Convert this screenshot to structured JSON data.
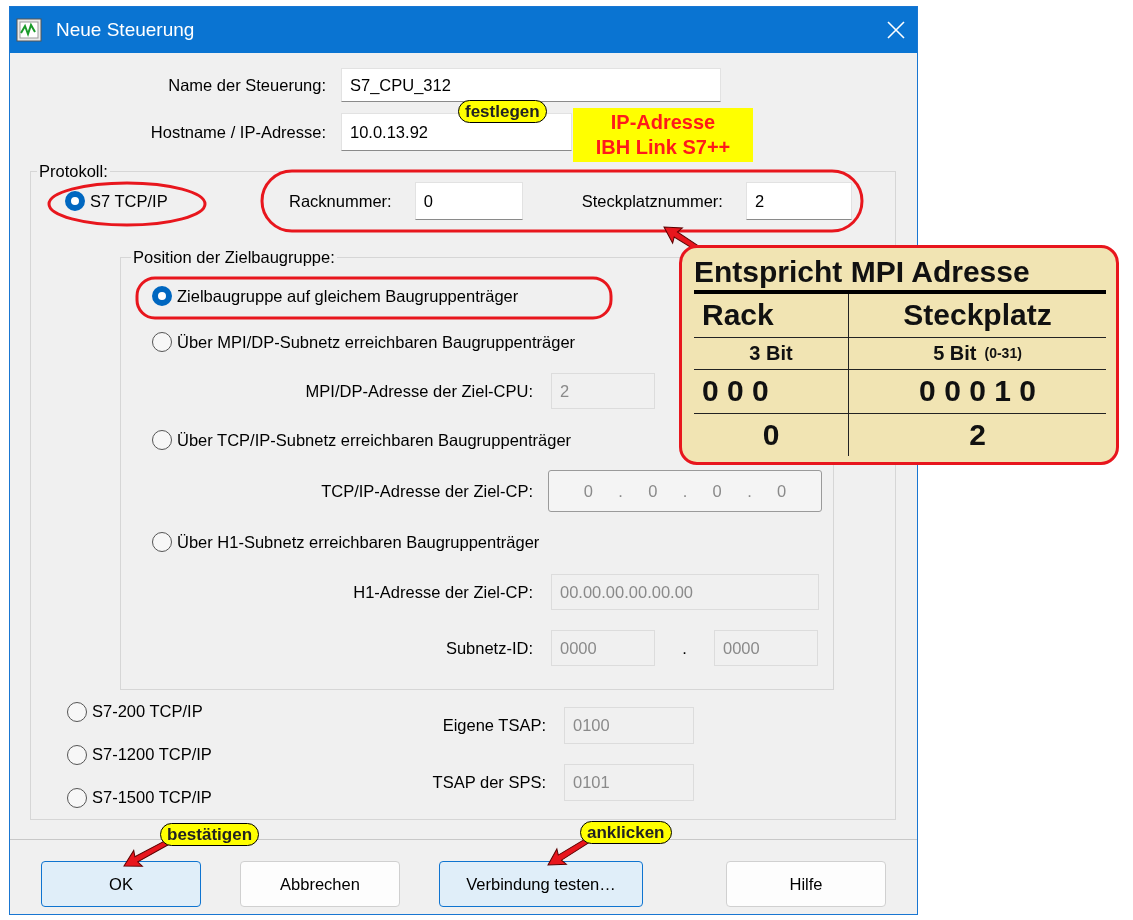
{
  "window": {
    "title": "Neue Steuerung"
  },
  "fields": [
    {
      "label": "Name der Steuerung:",
      "value": "S7_CPU_312"
    },
    {
      "label": "Hostname / IP-Adresse:",
      "value": "10.0.13.92"
    }
  ],
  "protocol_group": {
    "title": "Protokoll:",
    "protocols": [
      {
        "label": "S7 TCP/IP",
        "selected": true
      },
      {
        "label": "S7-200 TCP/IP",
        "selected": false
      },
      {
        "label": "S7-1200 TCP/IP",
        "selected": false
      },
      {
        "label": "S7-1500 TCP/IP",
        "selected": false
      }
    ],
    "rack": {
      "label": "Racknummer:",
      "value": "0"
    },
    "slot": {
      "label": "Steckplatznummer:",
      "value": "2"
    },
    "position_group": {
      "title": "Position der Zielbaugruppe:",
      "rows": [
        {
          "kind": "option",
          "label": "Zielbaugruppe auf gleichem Baugruppenträger",
          "selected": true
        },
        {
          "kind": "option",
          "label": "Über MPI/DP-Subnetz erreichbaren Baugruppenträger",
          "selected": false
        },
        {
          "kind": "field",
          "label": "MPI/DP-Adresse der Ziel-CPU:",
          "value": "2",
          "disabled": true
        },
        {
          "kind": "option",
          "label": "Über TCP/IP-Subnetz erreichbaren Baugruppenträger",
          "selected": false
        },
        {
          "kind": "ip",
          "label": "TCP/IP-Adresse der Ziel-CP:",
          "parts": [
            "0",
            "0",
            "0",
            "0"
          ],
          "separator": "."
        },
        {
          "kind": "option",
          "label": "Über H1-Subnetz erreichbaren Baugruppenträger",
          "selected": false
        },
        {
          "kind": "field",
          "label": "H1-Adresse der Ziel-CP:",
          "value": "00.00.00.00.00.00",
          "disabled": true,
          "wide": true
        },
        {
          "kind": "pair",
          "label": "Subnetz-ID:",
          "values": [
            "0000",
            "0000"
          ],
          "separator": ".",
          "disabled": true
        }
      ]
    },
    "tsap_fields": [
      {
        "label": "Eigene TSAP:",
        "value": "0100",
        "disabled": true
      },
      {
        "label": "TSAP der SPS:",
        "value": "0101",
        "disabled": true
      }
    ]
  },
  "buttons": [
    {
      "label": "OK",
      "highlighted": true
    },
    {
      "label": "Abbrechen",
      "highlighted": false
    },
    {
      "label": "Verbindung testen…",
      "highlighted": true
    },
    {
      "label": "Hilfe",
      "highlighted": false
    }
  ],
  "annotations": {
    "tags": [
      "festlegen",
      "bestätigen",
      "anklicken"
    ],
    "note": [
      "IP-Adresse",
      "IBH Link S7++"
    ],
    "callout": {
      "title": "Entspricht MPI Adresse",
      "columns": [
        "Rack",
        "Steckplatz"
      ],
      "rows": [
        {
          "rack": "3 Bit",
          "slot": "5 Bit",
          "slot_note": "(0-31)"
        },
        {
          "rack": "0 0 0",
          "slot": "0 0 0 1 0"
        },
        {
          "rack": "0",
          "slot": "2"
        }
      ]
    }
  }
}
